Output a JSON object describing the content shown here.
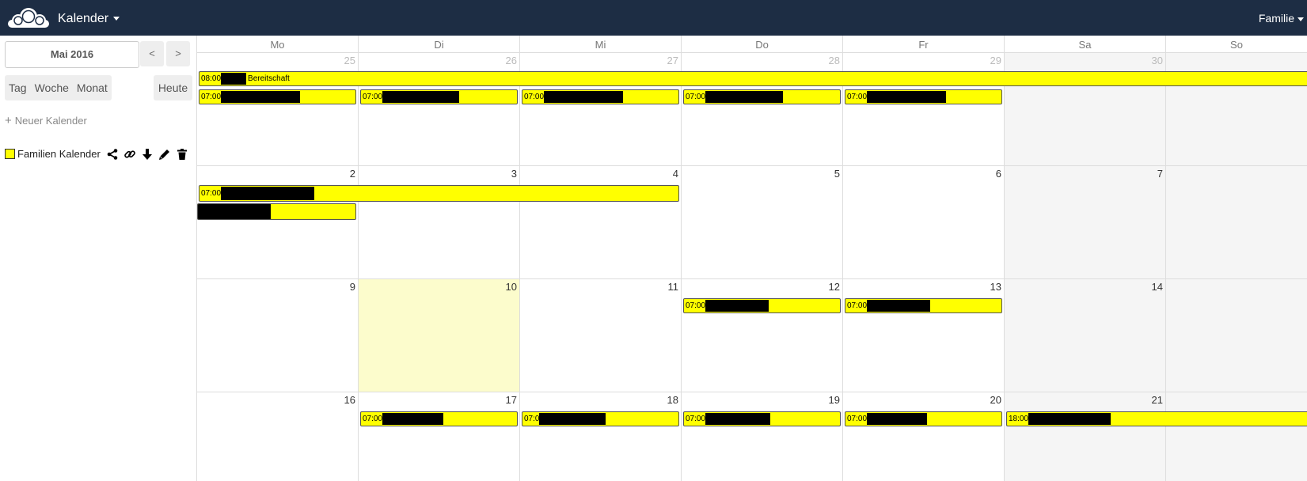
{
  "header": {
    "app_title": "Kalender",
    "user": "Familie"
  },
  "sidebar": {
    "month_label": "Mai 2016",
    "prev_label": "<",
    "next_label": ">",
    "views": [
      "Tag",
      "Woche",
      "Monat"
    ],
    "today_label": "Heute",
    "new_calendar_label": "Neuer Kalender",
    "calendar": {
      "name": "Familien Kalender",
      "color": "#ffff00"
    }
  },
  "calendar": {
    "weekdays": [
      "Mo",
      "Di",
      "Mi",
      "Do",
      "Fr",
      "Sa",
      "So"
    ],
    "weeks": [
      [
        "25",
        "26",
        "27",
        "28",
        "29",
        "30",
        ""
      ],
      [
        "2",
        "3",
        "4",
        "5",
        "6",
        "7",
        ""
      ],
      [
        "9",
        "10",
        "11",
        "12",
        "13",
        "14",
        ""
      ],
      [
        "16",
        "17",
        "18",
        "19",
        "20",
        "21",
        ""
      ]
    ],
    "events": {
      "w1_all": {
        "time": "08:00",
        "title": "Bereitschaft"
      },
      "w1_mo": {
        "time": "07:00"
      },
      "w1_di": {
        "time": "07:00"
      },
      "w1_mi": {
        "time": "07:00"
      },
      "w1_do": {
        "time": "07:00"
      },
      "w1_fr": {
        "time": "07:00"
      },
      "w2_span": {
        "time": "07:00"
      },
      "w2_mo": {
        "time": ""
      },
      "w3_do": {
        "time": "07:00"
      },
      "w3_fr": {
        "time": "07:00"
      },
      "w4_di": {
        "time": "07:00"
      },
      "w4_mi": {
        "time": "07:0"
      },
      "w4_do": {
        "time": "07:00"
      },
      "w4_fr": {
        "time": "07:00"
      },
      "w4_sa": {
        "time": "18:00"
      }
    }
  },
  "colors": {
    "header_bg": "#1d2d44",
    "event_bg": "#ffff00",
    "today_bg": "#fcfccc"
  }
}
